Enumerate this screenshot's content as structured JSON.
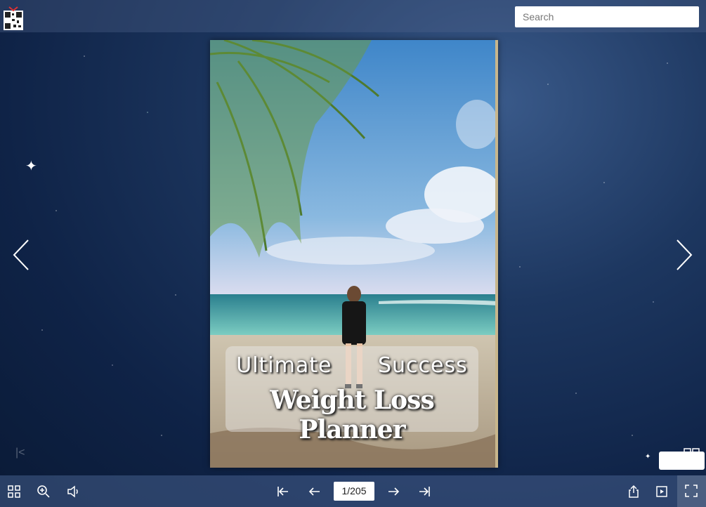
{
  "search": {
    "placeholder": "Search"
  },
  "book": {
    "title_line1": "Ultimate Success",
    "title_line2": "Weight Loss Planner"
  },
  "pagination": {
    "current": "1/205"
  },
  "icons": {
    "qr_code": "qr-code-icon",
    "prev_page": "chevron-left-icon",
    "next_page": "chevron-right-icon",
    "thumbnails": "grid-icon",
    "zoom": "zoom-in-icon",
    "sound": "speaker-icon",
    "first": "first-page-icon",
    "prev": "arrow-left-icon",
    "next": "arrow-right-icon",
    "last": "last-page-icon",
    "share": "share-icon",
    "autoplay": "play-icon",
    "fullscreen": "fullscreen-icon"
  }
}
